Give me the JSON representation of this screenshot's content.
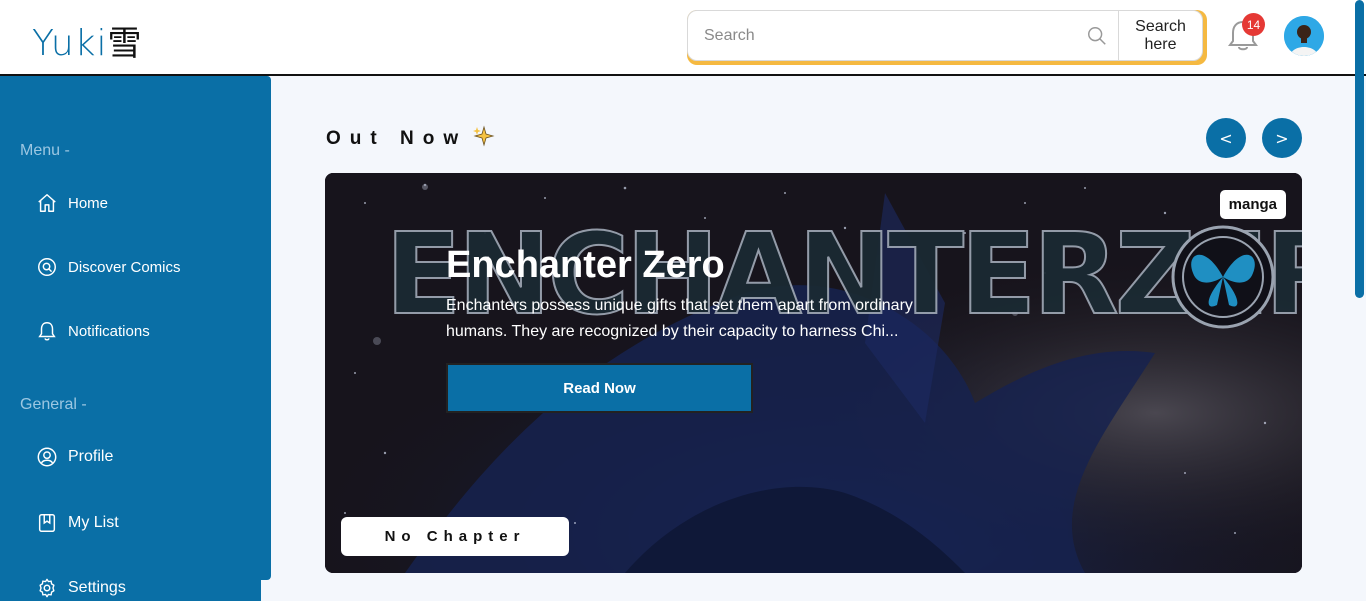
{
  "app": {
    "logo_text": "Yuki",
    "logo_kanji": "雪"
  },
  "header": {
    "search": {
      "placeholder": "Search",
      "button_label": "Search here"
    },
    "notifications_count": "14"
  },
  "sidebar": {
    "menu_title": "Menu -",
    "general_title": "General -",
    "menu_items": [
      {
        "label": "Home",
        "icon": "home-icon"
      },
      {
        "label": "Discover Comics",
        "icon": "discover-icon"
      },
      {
        "label": "Notifications",
        "icon": "bell-icon"
      }
    ],
    "general_items": [
      {
        "label": "Profile",
        "icon": "user-icon"
      },
      {
        "label": "My List",
        "icon": "bookmark-icon"
      },
      {
        "label": "Settings",
        "icon": "gear-icon"
      }
    ]
  },
  "main": {
    "section_title": "Out Now",
    "prev_label": "<",
    "next_label": ">",
    "featured": {
      "title": "Enchanter Zero",
      "description": "Enchanters possess unique gifts that set them apart from ordinary humans. They are recognized by their capacity to harness Chi...",
      "type_tag": "manga",
      "read_label": "Read Now",
      "chapter_label": "No Chapter",
      "banner_logo_text": "ENCHANTERZERO"
    }
  },
  "colors": {
    "primary": "#0a6fa6",
    "accent": "#f5b941",
    "badge": "#e53935"
  }
}
